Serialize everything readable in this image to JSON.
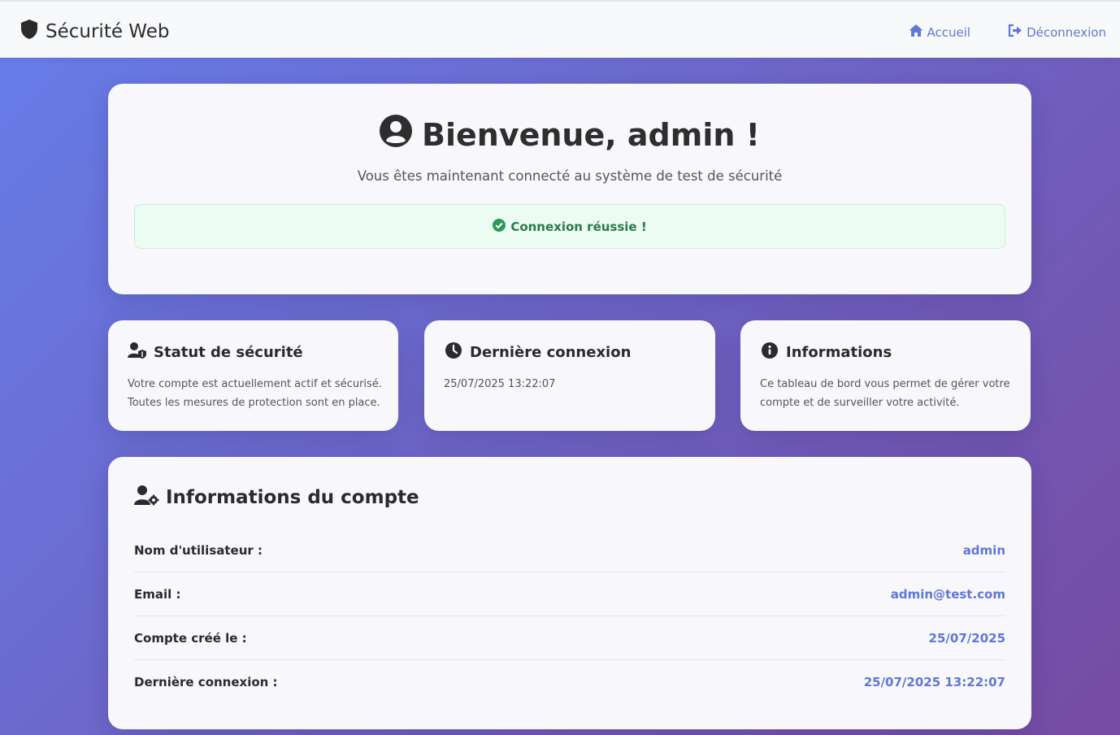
{
  "navbar": {
    "brand": "Sécurité Web",
    "links": [
      {
        "label": "Accueil",
        "icon": "home-icon"
      },
      {
        "label": "Déconnexion",
        "icon": "sign-out-icon"
      }
    ]
  },
  "welcome": {
    "title": "Bienvenue, admin !",
    "subtitle": "Vous êtes maintenant connecté au système de test de sécurité",
    "alert": "Connexion réussie !"
  },
  "cards": [
    {
      "title": "Statut de sécurité",
      "icon": "user-shield-icon",
      "text": "Votre compte est actuellement actif et sécurisé. Toutes les mesures de protection sont en place."
    },
    {
      "title": "Dernière connexion",
      "icon": "clock-icon",
      "text": "25/07/2025 13:22:07"
    },
    {
      "title": "Informations",
      "icon": "info-circle-icon",
      "text": "Ce tableau de bord vous permet de gérer votre compte et de surveiller votre activité."
    }
  ],
  "account": {
    "title": "Informations du compte",
    "rows": [
      {
        "label": "Nom d'utilisateur :",
        "value": "admin"
      },
      {
        "label": "Email :",
        "value": "admin@test.com"
      },
      {
        "label": "Compte créé le :",
        "value": "25/07/2025"
      },
      {
        "label": "Dernière connexion :",
        "value": "25/07/2025 13:22:07"
      }
    ]
  },
  "colors": {
    "accent": "#6077d6",
    "gradient_start": "#667eea",
    "gradient_end": "#764ba2",
    "success": "#2b7a4b"
  }
}
